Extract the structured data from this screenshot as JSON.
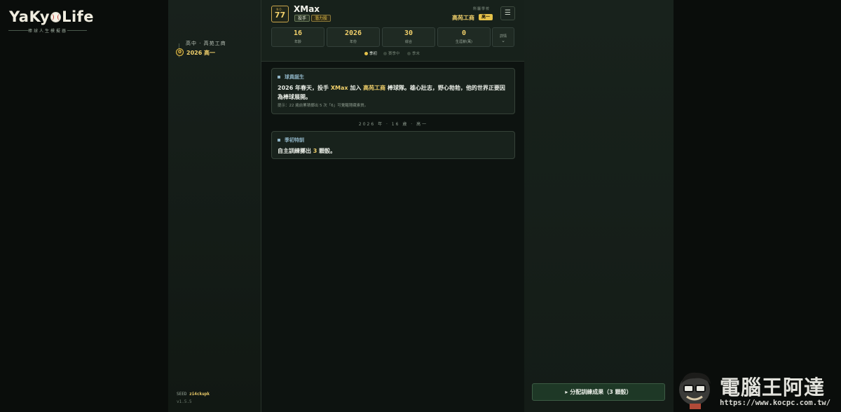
{
  "sidebar": {
    "logo_text_before": "YaKy",
    "logo_text_after": "Life",
    "logo_subtitle": "棒球人生模擬器",
    "stage_label": "高中 · 高苑工商",
    "stage_number": "0",
    "stage_year": "2026 高一",
    "seed_label": "SEED",
    "seed_value": "zi4ckupk",
    "version": "v1.5.5"
  },
  "header": {
    "no_label": "NO.",
    "number": "77",
    "player_name": "XMax",
    "position_tag": "投手",
    "potential_tag": "潛力股",
    "school_label": "所屬學校",
    "school_name": "高苑工商",
    "grade": "高一",
    "menu_icon": "hamburger-icon",
    "stats": [
      {
        "value": "16",
        "label": "年齡"
      },
      {
        "value": "2026",
        "label": "年份"
      },
      {
        "value": "30",
        "label": "綜合"
      },
      {
        "value": "0",
        "label": "生涯薪(萬)"
      }
    ],
    "detail_label": "詳情",
    "phases": [
      "季初",
      "賽季中",
      "季末"
    ],
    "active_phase": "季初"
  },
  "events": [
    {
      "title": "球員誕生",
      "body_parts": [
        "2026 年春天，投手 ",
        "XMax",
        " 加入 ",
        "高苑工商",
        " 棒球隊。雄心壯志，野心勃勃，他的世界正要因為棒球展開。"
      ],
      "hint": "提示：22 歲前累積擲出 5 次「6」可覺醒隱藏素質。"
    }
  ],
  "timeline_separator": "2026 年 · 16 歲 · 高一",
  "training": {
    "title": "季初特訓",
    "body_before": "自主訓練擲出 ",
    "dice_count": "3",
    "body_after": " 顆骰。"
  },
  "assign_button": "▸ 分配訓練成果（3 顆骰）",
  "watermark": {
    "text": "電腦王阿達",
    "url": "https://www.kocpc.com.tw/"
  },
  "colors": {
    "accent_gold": "#f1d06b",
    "section_title_blue": "#8fb4c6",
    "button_green": "#1e3826"
  }
}
